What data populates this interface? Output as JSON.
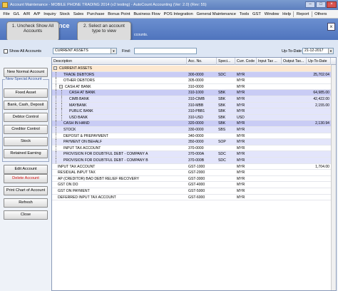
{
  "window": {
    "title": "Account Maintenance - MOBILE PHONE TRADING 2014 (v2 testing) - AutoCount Accounting (Ver: 2.0) (Rev: 55)",
    "min": "–",
    "max": "□",
    "close": "×"
  },
  "menu": [
    "File",
    "G/L",
    "A/R",
    "A/P",
    "Inquiry",
    "Stock",
    "Sales",
    "Purchase",
    "Bonus Point",
    "Business Flow",
    "POS Integration",
    "General Maintenance",
    "Tools",
    "GST",
    "Window",
    "Help",
    "Report",
    "Others"
  ],
  "banner": {
    "heading": "nce",
    "note": "ccounts.",
    "close": "×"
  },
  "callouts": {
    "first": "1. Uncheck Show All Accounts",
    "second": "2. Select an account type to view"
  },
  "filter": {
    "show_all_label": "Show All Accounts",
    "account_type": "CURRENT ASSETS",
    "find_label": "Find:",
    "up_to_date_label": "Up-To-Date",
    "up_to_date": "21-12-2017"
  },
  "buttons": {
    "new_normal": "New Normal Account",
    "special_group": "New Special Account",
    "fixed_asset": "Fixed Asset",
    "bank_cash": "Bank, Cash, Deposit",
    "debtor": "Debtor Control",
    "creditor": "Creditor Control",
    "stock": "Stock",
    "retained": "Retained Earning",
    "edit": "Edit Account",
    "delete": "Delete Account",
    "print": "Print Chart of Account",
    "refresh": "Refresh",
    "close": "Close"
  },
  "grid": {
    "columns": [
      "Description",
      "Acc. No.",
      "Speci...",
      "Curr. Code",
      "Input Tax ...",
      "Output Tax...",
      "Up-To-Date"
    ],
    "rows": [
      {
        "desc": "CURRENT ASSETS",
        "acc": "",
        "spec": "",
        "curr": "",
        "up": "",
        "style": "header",
        "indent": 0,
        "tree": "−"
      },
      {
        "desc": "TRADE DEBTORS",
        "acc": "300-0000",
        "spec": "SDC",
        "curr": "MYR",
        "up": "25,702.04",
        "style": "blue",
        "indent": 1,
        "tree": ""
      },
      {
        "desc": "OTHER DEBTORS",
        "acc": "305-0000",
        "spec": "",
        "curr": "MYR",
        "up": "",
        "style": "",
        "indent": 1,
        "tree": ""
      },
      {
        "desc": "CASH AT BANK",
        "acc": "310-0000",
        "spec": "",
        "curr": "MYR",
        "up": "",
        "style": "",
        "indent": 1,
        "tree": "−"
      },
      {
        "desc": "CASH AT BANK",
        "acc": "310-1000",
        "spec": "SBK",
        "curr": "MYR",
        "up": "64,985.00",
        "style": "blue",
        "indent": 2,
        "tree": ""
      },
      {
        "desc": "CIMB BANK",
        "acc": "310-CIMB",
        "spec": "SBK",
        "curr": "MYR",
        "up": "42,422.00",
        "style": "lavender",
        "indent": 2,
        "tree": ""
      },
      {
        "desc": "MAYBANK",
        "acc": "310-MBB",
        "spec": "SBK",
        "curr": "MYR",
        "up": "2,155.00",
        "style": "lavender",
        "indent": 2,
        "tree": ""
      },
      {
        "desc": "PUBLIC BANK",
        "acc": "310-PBB1",
        "spec": "SBK",
        "curr": "MYR",
        "up": "",
        "style": "lavender",
        "indent": 2,
        "tree": ""
      },
      {
        "desc": "USD BANK",
        "acc": "310-USD",
        "spec": "SBK",
        "curr": "USD",
        "up": "",
        "style": "lavender",
        "indent": 2,
        "tree": ""
      },
      {
        "desc": "CASH IN HAND",
        "acc": "320-0000",
        "spec": "SBK",
        "curr": "MYR",
        "up": "2,130.94",
        "style": "blue",
        "indent": 1,
        "tree": ""
      },
      {
        "desc": "STOCK",
        "acc": "330-0000",
        "spec": "SBS",
        "curr": "MYR",
        "up": "",
        "style": "lavender",
        "indent": 1,
        "tree": ""
      },
      {
        "desc": "DEPOSIT & PREPAYMENT",
        "acc": "340-0000",
        "spec": "",
        "curr": "MYR",
        "up": "",
        "style": "",
        "indent": 1,
        "tree": ""
      },
      {
        "desc": "PAYMENT ON BEHALF",
        "acc": "350-0000",
        "spec": "SOP",
        "curr": "MYR",
        "up": "",
        "style": "lavender",
        "indent": 1,
        "tree": ""
      },
      {
        "desc": "INPUT TAX ACCOUNT",
        "acc": "370-0000",
        "spec": "",
        "curr": "MYR",
        "up": "",
        "style": "",
        "indent": 1,
        "tree": ""
      },
      {
        "desc": "PROVISION FOR DOUBTFUL DEBT - COMPANY A",
        "acc": "370-000A",
        "spec": "SDC",
        "curr": "MYR",
        "up": "",
        "style": "lavender",
        "indent": 1,
        "tree": ""
      },
      {
        "desc": "PROVISION FOR DOUBTFUL DEBT - COMPANY B",
        "acc": "370-000B",
        "spec": "SDC",
        "curr": "MYR",
        "up": "",
        "style": "lavender",
        "indent": 1,
        "tree": ""
      },
      {
        "desc": "INPUT TAX ACCOUNT",
        "acc": "GST-1000",
        "spec": "",
        "curr": "MYR",
        "up": "1,704.00",
        "style": "",
        "indent": 0,
        "tree": ""
      },
      {
        "desc": "RESIDUAL INPUT TAX",
        "acc": "GST-2000",
        "spec": "",
        "curr": "MYR",
        "up": "",
        "style": "",
        "indent": 0,
        "tree": ""
      },
      {
        "desc": "AP (CREDITOR) BAD DEBT RELIEF RECOVERY",
        "acc": "GST-3000",
        "spec": "",
        "curr": "MYR",
        "up": "",
        "style": "",
        "indent": 0,
        "tree": ""
      },
      {
        "desc": "GST ON DO",
        "acc": "GST-4000",
        "spec": "",
        "curr": "MYR",
        "up": "",
        "style": "",
        "indent": 0,
        "tree": ""
      },
      {
        "desc": "GST ON PAYMENT",
        "acc": "GST-5000",
        "spec": "",
        "curr": "MYR",
        "up": "",
        "style": "",
        "indent": 0,
        "tree": ""
      },
      {
        "desc": "DEFERRED INPUT TAX ACCOUNT",
        "acc": "GST-6000",
        "spec": "",
        "curr": "MYR",
        "up": "",
        "style": "",
        "indent": 0,
        "tree": ""
      }
    ]
  },
  "colors": {
    "banner": "#5a7ec5",
    "row_blue": "#c9ccf5",
    "row_lavender": "#e3e5fb",
    "row_header": "#fde8d0",
    "delete_text": "#d01010"
  }
}
